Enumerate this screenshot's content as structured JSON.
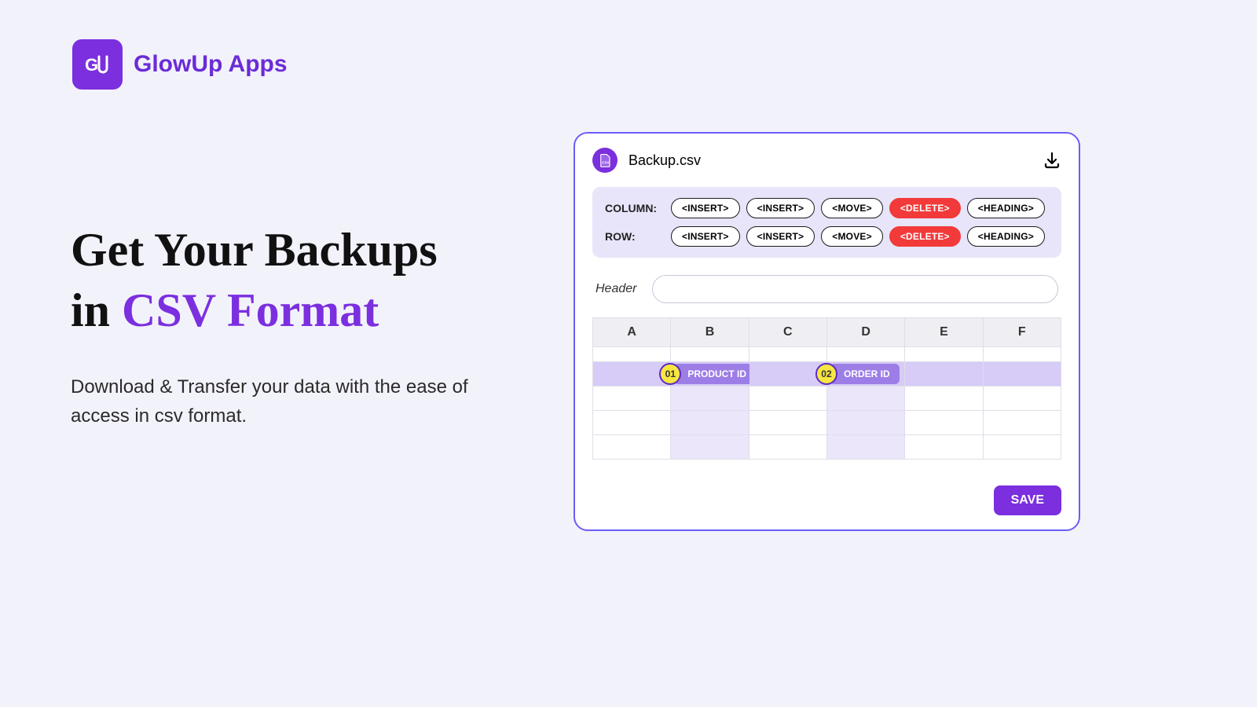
{
  "brand": {
    "name": "GlowUp Apps",
    "logo_text": "GU"
  },
  "hero": {
    "title_line1": "Get Your Backups",
    "title_line2_prefix": "in ",
    "title_line2_accent": "CSV Format",
    "subtitle": "Download & Transfer your data with the ease of access in csv format."
  },
  "panel": {
    "file_name": "Backup.csv",
    "toolbar": {
      "column_label": "COLUMN:",
      "row_label": "ROW:",
      "buttons": {
        "insert1": "<INSERT>",
        "insert2": "<INSERT>",
        "move": "<MOVE>",
        "delete": "<DELETE>",
        "heading": "<HEADING>"
      }
    },
    "header_label": "Header",
    "columns": [
      "A",
      "B",
      "C",
      "D",
      "E",
      "F"
    ],
    "badges": [
      {
        "num": "01",
        "label": "PRODUCT ID"
      },
      {
        "num": "02",
        "label": "ORDER ID"
      }
    ],
    "save_label": "SAVE"
  }
}
